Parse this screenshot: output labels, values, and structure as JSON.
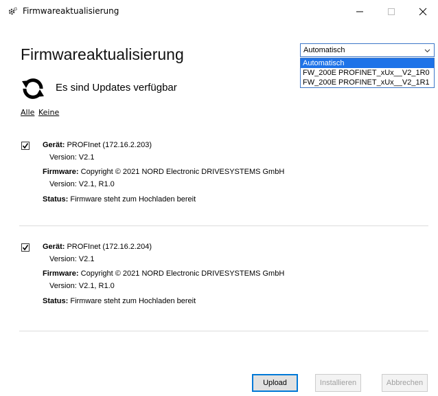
{
  "window": {
    "title": "Firmwareaktualisierung",
    "icon": "gear-cog-icon",
    "controls": [
      "minimize-icon",
      "maximize-icon",
      "close-icon"
    ]
  },
  "main": {
    "heading": "Firmwareaktualisierung",
    "status_icon": "refresh-icon",
    "status_text": "Es sind Updates verfügbar",
    "links": {
      "all": "Alle",
      "none": "Keine"
    }
  },
  "firmware_select": {
    "selected": "Automatisch",
    "options": [
      "Automatisch",
      "FW_200E PROFINET_xUx__V2_1R0",
      "FW_200E PROFINET_xUx__V2_1R1"
    ]
  },
  "devices": [
    {
      "checked": true,
      "device_label": "Gerät:",
      "device_value": "PROFInet (172.16.2.203)",
      "device_version": "Version: V2.1",
      "firmware_label": "Firmware:",
      "firmware_value": "Copyright © 2021 NORD Electronic DRIVESYSTEMS GmbH",
      "firmware_version": "Version: V2.1, R1.0",
      "status_label": "Status:",
      "status_value": "Firmware steht zum Hochladen bereit"
    },
    {
      "checked": true,
      "device_label": "Gerät:",
      "device_value": "PROFInet (172.16.2.204)",
      "device_version": "Version: V2.1",
      "firmware_label": "Firmware:",
      "firmware_value": "Copyright © 2021 NORD Electronic DRIVESYSTEMS GmbH",
      "firmware_version": "Version: V2.1, R1.0",
      "status_label": "Status:",
      "status_value": "Firmware steht zum Hochladen bereit"
    }
  ],
  "buttons": {
    "upload": "Upload",
    "install": "Installieren",
    "cancel": "Abbrechen"
  },
  "colors": {
    "accent": "#0078d7",
    "selection": "#1e73e8",
    "disabled_text": "#a0a0a0"
  }
}
